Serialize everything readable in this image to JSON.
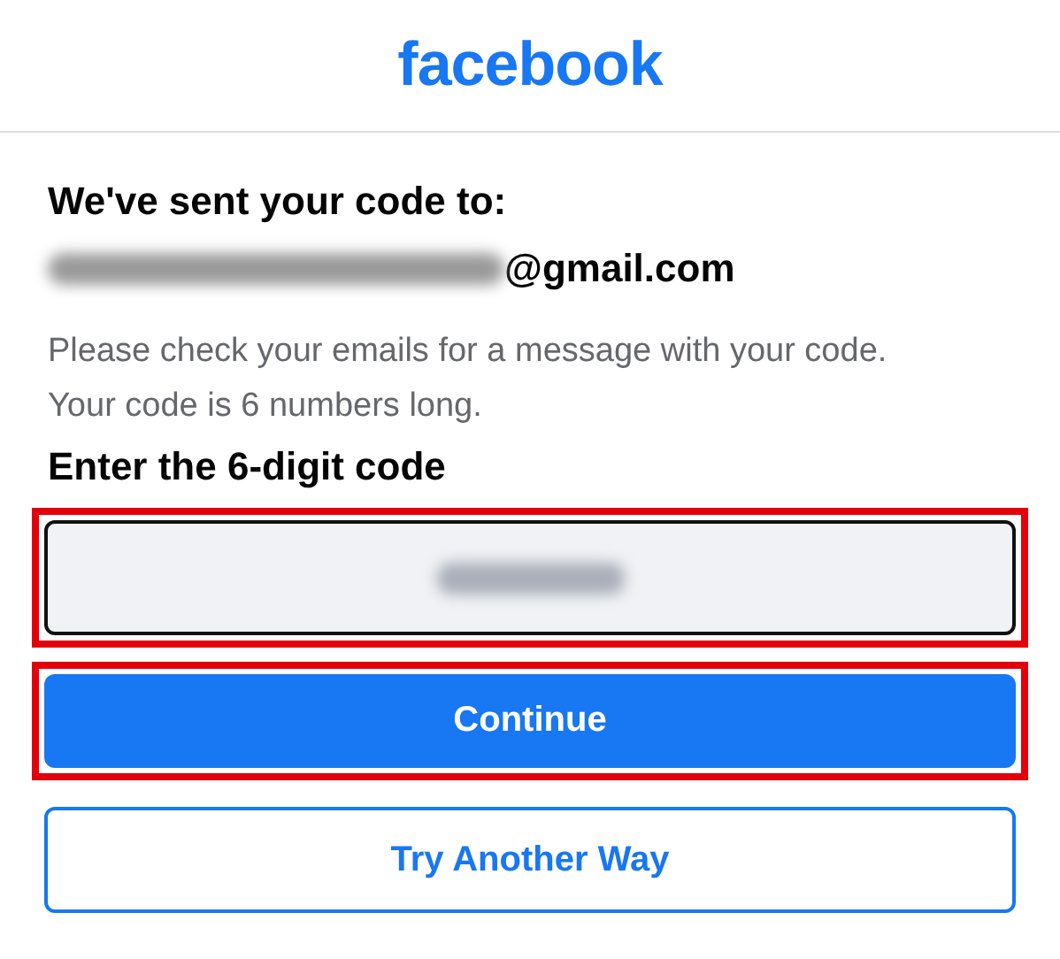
{
  "header": {
    "logo": "facebook"
  },
  "heading": "We've sent your code to:",
  "email": {
    "redacted": true,
    "domain": "@gmail.com"
  },
  "instructions": "Please check your emails for a message with your code. Your code is 6 numbers long.",
  "code_label": "Enter the 6-digit code",
  "code_field": {
    "redacted": true,
    "highlighted": true
  },
  "buttons": [
    {
      "label": "Continue",
      "kind": "primary",
      "highlighted": true
    },
    {
      "label": "Try Another Way",
      "kind": "secondary",
      "highlighted": false
    }
  ]
}
